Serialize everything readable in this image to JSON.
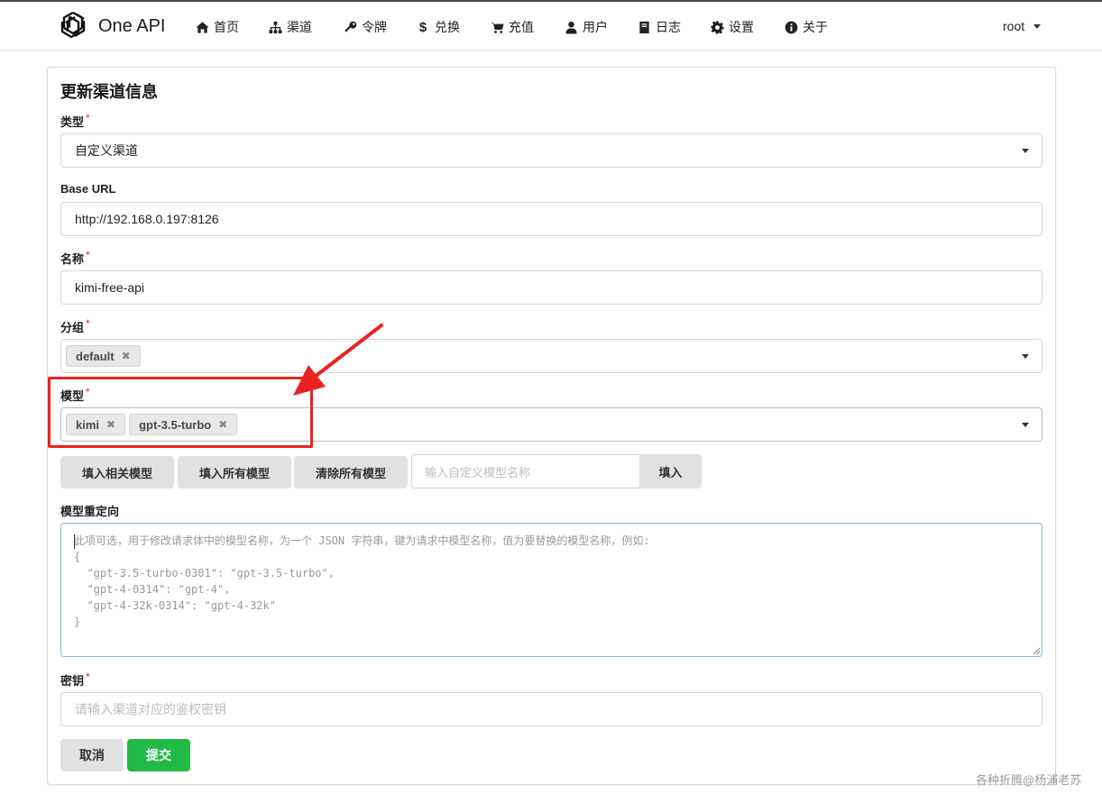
{
  "header": {
    "brand": "One API",
    "nav": [
      {
        "label": "首页",
        "icon": "home-icon"
      },
      {
        "label": "渠道",
        "icon": "sitemap-icon"
      },
      {
        "label": "令牌",
        "icon": "key-icon"
      },
      {
        "label": "兑换",
        "icon": "dollar-icon"
      },
      {
        "label": "充值",
        "icon": "cart-icon"
      },
      {
        "label": "用户",
        "icon": "user-icon"
      },
      {
        "label": "日志",
        "icon": "book-icon"
      },
      {
        "label": "设置",
        "icon": "gear-icon"
      },
      {
        "label": "关于",
        "icon": "info-icon"
      }
    ],
    "user": "root"
  },
  "form": {
    "title": "更新渠道信息",
    "type": {
      "label": "类型",
      "value": "自定义渠道"
    },
    "base_url": {
      "label": "Base URL",
      "value": "http://192.168.0.197:8126"
    },
    "name": {
      "label": "名称",
      "value": "kimi-free-api"
    },
    "group": {
      "label": "分组",
      "chips": [
        "default"
      ]
    },
    "models": {
      "label": "模型",
      "chips": [
        "kimi",
        "gpt-3.5-turbo"
      ]
    },
    "model_buttons": {
      "fill_related": "填入相关模型",
      "fill_all": "填入所有模型",
      "clear_all": "清除所有模型",
      "custom_placeholder": "输入自定义模型名称",
      "fill": "填入"
    },
    "model_mapping": {
      "label": "模型重定向",
      "placeholder": "此项可选，用于修改请求体中的模型名称，为一个 JSON 字符串，键为请求中模型名称，值为要替换的模型名称，例如:\n{\n  \"gpt-3.5-turbo-0301\": \"gpt-3.5-turbo\",\n  \"gpt-4-0314\": \"gpt-4\",\n  \"gpt-4-32k-0314\": \"gpt-4-32k\"\n}"
    },
    "key": {
      "label": "密钥",
      "placeholder": "请输入渠道对应的鉴权密钥"
    },
    "required_mark": "*",
    "cancel": "取消",
    "submit": "提交"
  },
  "watermark": "各种折腾@杨浦老苏",
  "colors": {
    "highlight": "#e8231f",
    "submit": "#21ba45",
    "required": "#db2828"
  }
}
